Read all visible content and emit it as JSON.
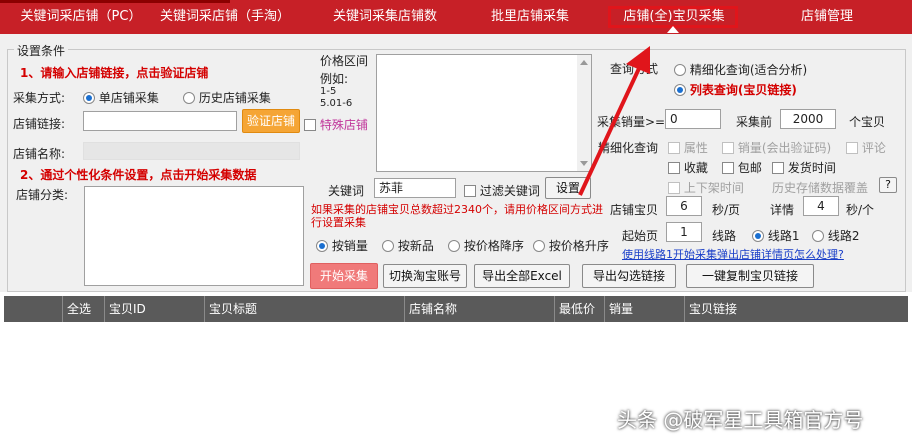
{
  "tabs": [
    {
      "label": "关键词采店铺（PC）"
    },
    {
      "label": "关键词采店铺（手淘）"
    },
    {
      "label": "关键词采集店铺数"
    },
    {
      "label": "批里店铺采集"
    },
    {
      "label": "店铺(全)宝贝采集"
    },
    {
      "label": "店铺管理"
    }
  ],
  "settings": {
    "legend": "设置条件",
    "step1": "1、请输入店铺链接，点击验证店铺",
    "collect_mode_label": "采集方式:",
    "mode_single": "单店铺采集",
    "mode_history": "历史店铺采集",
    "shop_link_label": "店铺链接:",
    "verify_button": "验证店铺",
    "special_shop": "特殊店铺",
    "shop_name_label": "店铺名称:",
    "step2": "2、通过个性化条件设置，点击开始采集数据",
    "shop_category_label": "店铺分类:",
    "price_range_label": "价格区间",
    "price_example_title": "例如:",
    "price_example_1": "1-5",
    "price_example_2": "5.01-6",
    "keyword_label": "关键词",
    "keyword_value": "苏菲",
    "filter_keyword": "过滤关键词",
    "set_button": "设置",
    "warning": "如果采集的店铺宝贝总数超过2340个，请用价格区间方式进行设置采集",
    "sort_sales": "按销量",
    "sort_new": "按新品",
    "sort_price_desc": "按价格降序",
    "sort_price_asc": "按价格升序"
  },
  "query": {
    "mode_label": "查询方式",
    "fine_query": "精细化查询(适合分析)",
    "list_query": "列表查询(宝贝链接)",
    "sales_label": "采集销量>=",
    "sales_value": "0",
    "top_label": "采集前",
    "top_value": "2000",
    "top_unit": "个宝贝",
    "fine_label": "精细化查询",
    "attr": "属性",
    "sales_need": "销量(会出验证码)",
    "review": "评论",
    "favorite": "收藏",
    "free_ship": "包邮",
    "ship_time": "发货时间",
    "listing_time": "上下架时间",
    "history_cover": "历史存储数据覆盖",
    "help_button": "?",
    "shop_item_label": "店铺宝贝",
    "shop_item_value": "6",
    "shop_item_unit": "秒/页",
    "detail_label": "详情",
    "detail_value": "4",
    "detail_unit": "秒/个",
    "start_page_label": "起始页",
    "start_page_value": "1",
    "line_label": "线路",
    "line1": "线路1",
    "line2": "线路2",
    "line_help_link": "使用线路1开始采集弹出店铺详情页怎么处理?"
  },
  "actions": {
    "start": "开始采集",
    "switch_account": "切换淘宝账号",
    "export_all": "导出全部Excel",
    "export_checked": "导出勾选链接",
    "copy_links": "一键复制宝贝链接"
  },
  "table": {
    "columns": [
      "全选",
      "宝贝ID",
      "宝贝标题",
      "店铺名称",
      "最低价",
      "销量",
      "宝贝链接"
    ]
  },
  "watermark": "头条 @破军星工具箱官方号"
}
